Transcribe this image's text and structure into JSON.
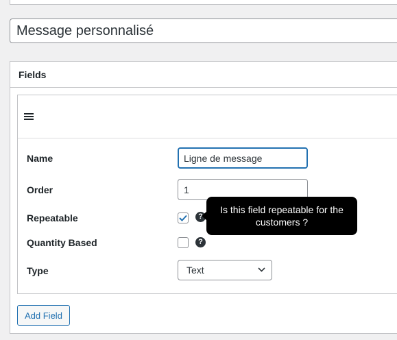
{
  "post": {
    "title": "Message personnalisé"
  },
  "fields_box": {
    "title": "Fields",
    "field": {
      "name_label": "Name",
      "name_value": "Ligne de message",
      "order_label": "Order",
      "order_value": "1",
      "repeatable_label": "Repeatable",
      "repeatable_checked": true,
      "repeatable_help": "Is this field repeatable for the customers ?",
      "quantity_label": "Quantity Based",
      "quantity_checked": false,
      "type_label": "Type",
      "type_value": "Text",
      "icons": {
        "drag": "hamburger-menu-icon",
        "help": "question-circle-icon",
        "select": "chevron-down-icon",
        "check": "checkmark-icon"
      }
    },
    "add_button": "Add Field"
  },
  "colors": {
    "accent": "#2271b1",
    "tooltip_bg": "#000000",
    "page_bg": "#f0f0f1"
  }
}
